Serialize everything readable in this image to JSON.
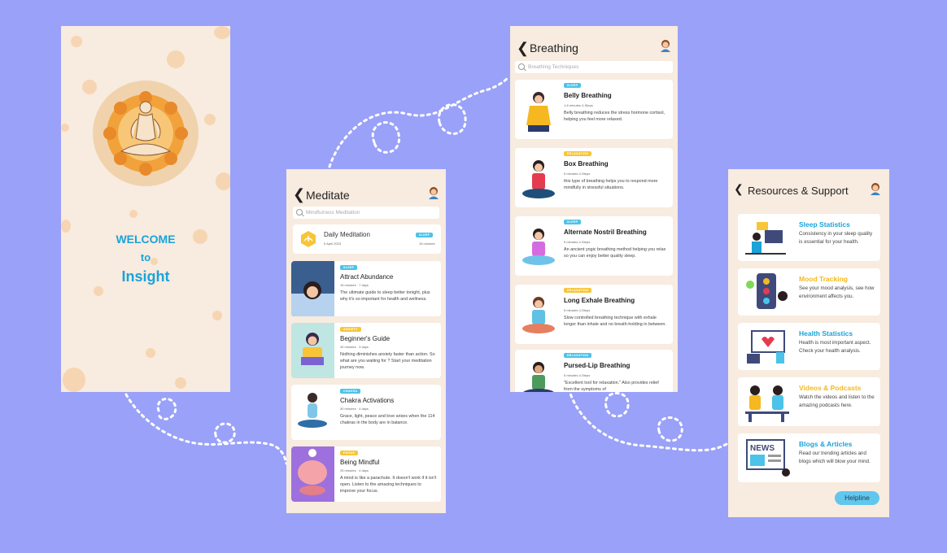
{
  "colors": {
    "background": "#9aa1f8",
    "screen": "#f8ebdf",
    "accent_blue": "#1aa3d9",
    "tag_blue": "#4cc3e8",
    "tag_yellow": "#f7c537"
  },
  "welcome": {
    "line1": "WELCOME",
    "line2": "to",
    "line3": "Insight"
  },
  "meditate": {
    "title": "Meditate",
    "search_placeholder": "Mindfulness Meditation",
    "daily": {
      "title": "Daily Meditation",
      "date": "5 April 2023",
      "tag": "SLEEP",
      "duration": "15 minutes"
    },
    "items": [
      {
        "tag": "SLEEP",
        "title": "Attract Abundance",
        "meta": "15 minutes · 7 days",
        "desc": "The ultimate guide to sleep better tonight, plus why it's so important for health and wellness."
      },
      {
        "tag": "ANXIETY",
        "title": "Beginner's Guide",
        "meta": "40 minutes · 3 days",
        "desc": "Nothing diminishes anxiety faster than action. So what are you waiting for ? Start your meditation journey now."
      },
      {
        "tag": "CHAKRA",
        "title": "Chakra Activations",
        "meta": "30 minutes · 4 days",
        "desc": "Grace, light, peace and love arises when the 114 chakras in the body are in balance."
      },
      {
        "tag": "FOCUS",
        "title": "Being Mindful",
        "meta": "25 minutes · 4 days",
        "desc": "A mind is like a parachute. It doesn't work if it isn't open. Listen to the amazing techniques to improve your focus."
      }
    ]
  },
  "breathing": {
    "title": "Breathing",
    "search_placeholder": "Breathing Techniques",
    "items": [
      {
        "tag": "SLEEP",
        "title": "Belly Breathing",
        "meta": "1-6 minutes   4-Steps",
        "desc": "Belly breathing reduces the stress hormone cortisol, helping you feel more relaxed."
      },
      {
        "tag": "RELAXATION",
        "title": "Box Breathing",
        "meta": "5 minutes   4-Steps",
        "desc": "this type of breathing helps you to respond more mindfully in stressful situations."
      },
      {
        "tag": "SLEEP",
        "title": "Alternate Nostril Breathing",
        "meta": "5 minutes   4-Steps",
        "desc": "An ancient yogic breathing method helping you relax so you can enjoy better quality sleep."
      },
      {
        "tag": "RELAXATION",
        "title": "Long Exhale Breathing",
        "meta": "5 minutes   4-Steps",
        "desc": "Slow controlled breathing technique with exhale longer than inhale and no breath-holding in between."
      },
      {
        "tag": "RELAXATION",
        "title": "Pursed-Lip Breathing",
        "meta": "5 minutes   4-Steps",
        "desc": "\"Excellent tool for relaxation.\" Also provides relief from the symptoms of"
      }
    ]
  },
  "resources": {
    "title": "Resources & Support",
    "items": [
      {
        "title": "Sleep Statistics",
        "color": "#1aa3d9",
        "desc": "Consistency in your sleep quality is essential for your health."
      },
      {
        "title": "Mood Tracking",
        "color": "#f5b821",
        "desc": "See your mood analysis, see how environment affects you."
      },
      {
        "title": "Health Statistics",
        "color": "#1aa3d9",
        "desc": "Health is most important aspect. Check your health analysis."
      },
      {
        "title": "Videos & Podcasts",
        "color": "#f5b821",
        "desc": "Watch the videos and listen to the amazing podcasts here."
      },
      {
        "title": "Blogs & Articles",
        "color": "#1aa3d9",
        "desc": "Read our trending articles and blogs which will blow your mind."
      }
    ],
    "helpline": "Helpline",
    "news_logo": "NEWS"
  }
}
